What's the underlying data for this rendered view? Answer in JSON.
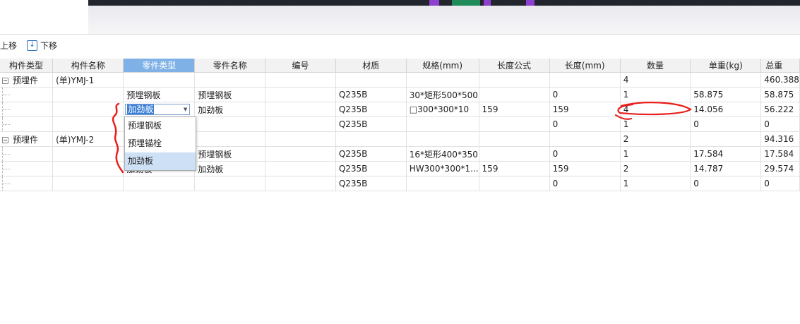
{
  "toolbar": {
    "move_up_label": "上移",
    "move_down_label": "下移",
    "move_down_icon": "arrow-down-icon"
  },
  "grid": {
    "columns": [
      "构件类型",
      "构件名称",
      "零件类型",
      "零件名称",
      "编号",
      "材质",
      "规格(mm)",
      "长度公式",
      "长度(mm)",
      "数量",
      "单重(kg)",
      "总重"
    ],
    "selected_column": "零件类型",
    "rows": [
      {
        "kind": "group",
        "cells": [
          "预埋件",
          "(单)YMJ-1",
          "",
          "",
          "",
          "",
          "",
          "",
          "",
          "4",
          "",
          "460.388"
        ]
      },
      {
        "kind": "child",
        "cells": [
          "",
          "",
          "预埋钢板",
          "预埋钢板",
          "",
          "Q235B",
          "30*矩形500*500",
          "",
          "0",
          "1",
          "58.875",
          "58.875"
        ]
      },
      {
        "kind": "child",
        "cells": [
          "",
          "",
          "",
          "加劲板",
          "",
          "Q235B",
          "□300*300*10",
          "159",
          "159",
          "4",
          "14.056",
          "56.222"
        ]
      },
      {
        "kind": "child",
        "cells": [
          "",
          "",
          "",
          "",
          "",
          "Q235B",
          "",
          "",
          "0",
          "1",
          "0",
          "0"
        ]
      },
      {
        "kind": "group",
        "cells": [
          "预埋件",
          "(单)YMJ-2",
          "",
          "",
          "",
          "",
          "",
          "",
          "",
          "2",
          "",
          "94.316"
        ]
      },
      {
        "kind": "child",
        "cells": [
          "",
          "",
          "",
          "预埋钢板",
          "",
          "Q235B",
          "16*矩形400*350",
          "",
          "0",
          "1",
          "17.584",
          "17.584"
        ]
      },
      {
        "kind": "child",
        "cells": [
          "",
          "",
          "加劲板",
          "加劲板",
          "",
          "Q235B",
          "HW300*300*1...",
          "159",
          "159",
          "2",
          "14.787",
          "29.574"
        ]
      },
      {
        "kind": "child",
        "cells": [
          "",
          "",
          "",
          "",
          "",
          "Q235B",
          "",
          "",
          "0",
          "1",
          "0",
          "0"
        ]
      }
    ]
  },
  "combo": {
    "value": "加劲板"
  },
  "dropdown": {
    "options": [
      "预埋钢板",
      "预埋锚栓",
      "加劲板"
    ],
    "highlighted_index": 2
  },
  "colors": {
    "selected_header": "#7fb1e6",
    "selection": "#3b7fd6",
    "annotation": "#e8201c"
  }
}
